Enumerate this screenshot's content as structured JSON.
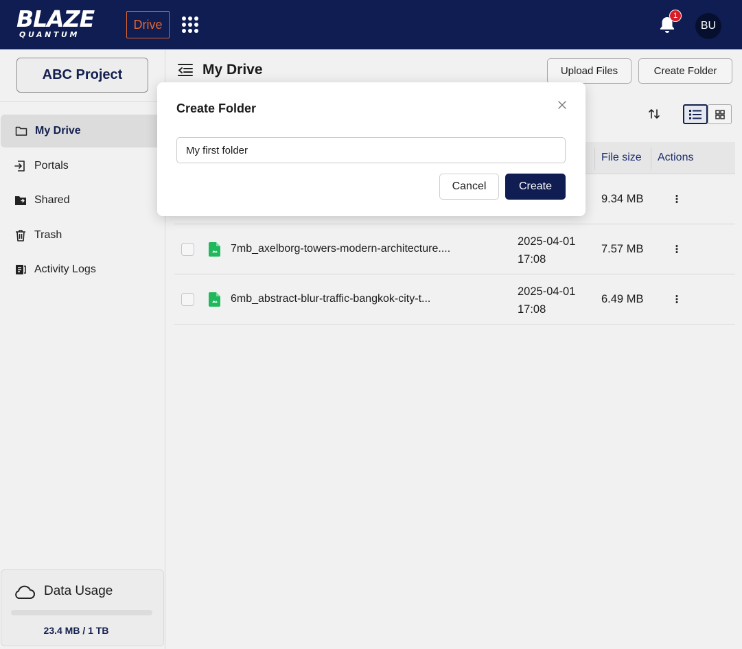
{
  "header": {
    "logo_top": "BLAZE",
    "logo_bottom": "QUANTUM",
    "app_badge": "Drive",
    "notifications_count": "1",
    "avatar_initials": "BU",
    "icons": [
      "apps-grid-icon",
      "bell-icon"
    ]
  },
  "sidebar": {
    "project": "ABC Project",
    "items": [
      {
        "label": "My Drive",
        "icon": "folder-icon",
        "active": true
      },
      {
        "label": "Portals",
        "icon": "portal-enter-icon",
        "active": false
      },
      {
        "label": "Shared",
        "icon": "shared-folder-icon",
        "active": false
      },
      {
        "label": "Trash",
        "icon": "trash-icon",
        "active": false
      },
      {
        "label": "Activity Logs",
        "icon": "activity-log-icon",
        "active": false
      }
    ],
    "data_usage": {
      "title": "Data Usage",
      "value": "23.4 MB / 1 TB",
      "fraction_used": 2.34e-05
    }
  },
  "main": {
    "title": "My Drive",
    "upload_label": "Upload Files",
    "create_folder_label": "Create Folder",
    "columns": {
      "file_size": "File size",
      "actions": "Actions"
    },
    "rows": [
      {
        "name": "",
        "date_line1": "",
        "date_line2": "",
        "size": "9.34 MB"
      },
      {
        "name": "7mb_axelborg-towers-modern-architecture....",
        "date_line1": "2025-04-01",
        "date_line2": "17:08",
        "size": "7.57 MB"
      },
      {
        "name": "6mb_abstract-blur-traffic-bangkok-city-t...",
        "date_line1": "2025-04-01",
        "date_line2": "17:08",
        "size": "6.49 MB"
      }
    ]
  },
  "modal": {
    "title": "Create Folder",
    "input_value": "My first folder",
    "cancel_label": "Cancel",
    "create_label": "Create"
  },
  "colors": {
    "navy": "#0f1d52",
    "accent_orange": "#e5652e",
    "notification_red": "#d51e28",
    "file_green": "#1fb85b"
  }
}
